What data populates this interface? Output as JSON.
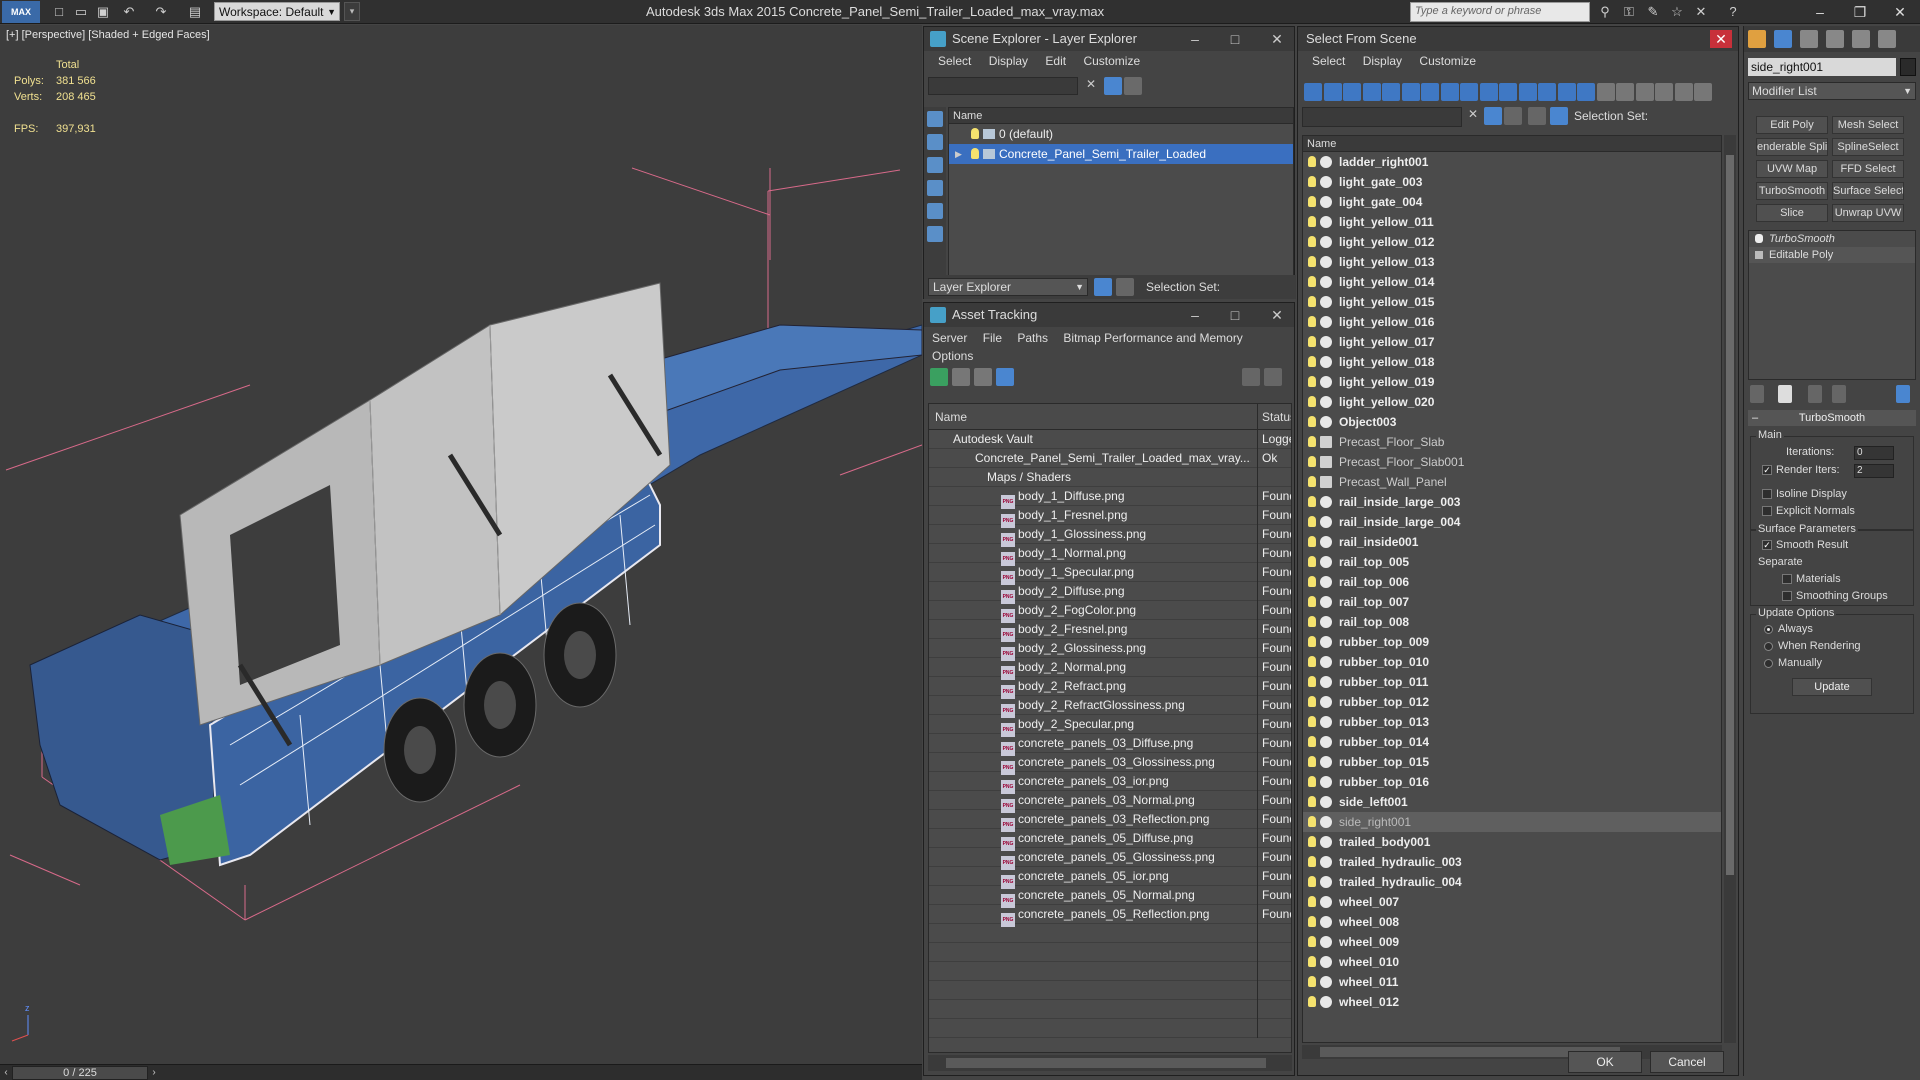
{
  "titlebar": {
    "logo": "MAX",
    "workspace": "Workspace: Default",
    "title": "Autodesk 3ds Max  2015     Concrete_Panel_Semi_Trailer_Loaded_max_vray.max",
    "search_placeholder": "Type a keyword or phrase"
  },
  "viewport": {
    "label": "[+] [Perspective] [Shaded + Edged Faces]",
    "stats_total": "Total",
    "polys_label": "Polys:",
    "polys_value": "381 566",
    "verts_label": "Verts:",
    "verts_value": "208 465",
    "fps_label": "FPS:",
    "fps_value": "397,931"
  },
  "statusbar": {
    "frame": "0 / 225"
  },
  "scene_explorer": {
    "title": "Scene Explorer - Layer Explorer",
    "menu": [
      "Select",
      "Display",
      "Edit",
      "Customize"
    ],
    "column": "Name",
    "rows": [
      "0 (default)",
      "Concrete_Panel_Semi_Trailer_Loaded"
    ],
    "layer_dropdown": "Layer Explorer",
    "selection_set": "Selection Set:"
  },
  "asset_tracking": {
    "title": "Asset Tracking",
    "menu": [
      "Server",
      "File",
      "Paths",
      "Bitmap Performance and Memory",
      "Options"
    ],
    "col_name": "Name",
    "col_status": "Status",
    "vault": {
      "name": "Autodesk Vault",
      "status": "Logge"
    },
    "file": {
      "name": "Concrete_Panel_Semi_Trailer_Loaded_max_vray....",
      "status": "Ok"
    },
    "maps": "Maps / Shaders",
    "found": "Found",
    "png": "PNG",
    "files": [
      "body_1_Diffuse.png",
      "body_1_Fresnel.png",
      "body_1_Glossiness.png",
      "body_1_Normal.png",
      "body_1_Specular.png",
      "body_2_Diffuse.png",
      "body_2_FogColor.png",
      "body_2_Fresnel.png",
      "body_2_Glossiness.png",
      "body_2_Normal.png",
      "body_2_Refract.png",
      "body_2_RefractGlossiness.png",
      "body_2_Specular.png",
      "concrete_panels_03_Diffuse.png",
      "concrete_panels_03_Glossiness.png",
      "concrete_panels_03_ior.png",
      "concrete_panels_03_Normal.png",
      "concrete_panels_03_Reflection.png",
      "concrete_panels_05_Diffuse.png",
      "concrete_panels_05_Glossiness.png",
      "concrete_panels_05_ior.png",
      "concrete_panels_05_Normal.png",
      "concrete_panels_05_Reflection.png"
    ]
  },
  "select_from_scene": {
    "title": "Select From Scene",
    "menu": [
      "Select",
      "Display",
      "Customize"
    ],
    "selection_set": "Selection Set:",
    "column": "Name",
    "objects": [
      {
        "name": "ladder_right001",
        "style": "normal"
      },
      {
        "name": "light_gate_003",
        "style": "normal"
      },
      {
        "name": "light_gate_004",
        "style": "normal"
      },
      {
        "name": "light_yellow_011",
        "style": "normal"
      },
      {
        "name": "light_yellow_012",
        "style": "normal"
      },
      {
        "name": "light_yellow_013",
        "style": "normal"
      },
      {
        "name": "light_yellow_014",
        "style": "normal"
      },
      {
        "name": "light_yellow_015",
        "style": "normal"
      },
      {
        "name": "light_yellow_016",
        "style": "normal"
      },
      {
        "name": "light_yellow_017",
        "style": "normal"
      },
      {
        "name": "light_yellow_018",
        "style": "normal"
      },
      {
        "name": "light_yellow_019",
        "style": "normal"
      },
      {
        "name": "light_yellow_020",
        "style": "normal"
      },
      {
        "name": "Object003",
        "style": "normal"
      },
      {
        "name": "Precast_Floor_Slab",
        "style": "dim"
      },
      {
        "name": "Precast_Floor_Slab001",
        "style": "dim"
      },
      {
        "name": "Precast_Wall_Panel",
        "style": "dim"
      },
      {
        "name": "rail_inside_large_003",
        "style": "normal"
      },
      {
        "name": "rail_inside_large_004",
        "style": "normal"
      },
      {
        "name": "rail_inside001",
        "style": "normal"
      },
      {
        "name": "rail_top_005",
        "style": "normal"
      },
      {
        "name": "rail_top_006",
        "style": "normal"
      },
      {
        "name": "rail_top_007",
        "style": "normal"
      },
      {
        "name": "rail_top_008",
        "style": "normal"
      },
      {
        "name": "rubber_top_009",
        "style": "normal"
      },
      {
        "name": "rubber_top_010",
        "style": "normal"
      },
      {
        "name": "rubber_top_011",
        "style": "normal"
      },
      {
        "name": "rubber_top_012",
        "style": "normal"
      },
      {
        "name": "rubber_top_013",
        "style": "normal"
      },
      {
        "name": "rubber_top_014",
        "style": "normal"
      },
      {
        "name": "rubber_top_015",
        "style": "normal"
      },
      {
        "name": "rubber_top_016",
        "style": "normal"
      },
      {
        "name": "side_left001",
        "style": "normal"
      },
      {
        "name": "side_right001",
        "style": "selected"
      },
      {
        "name": "trailed_body001",
        "style": "normal"
      },
      {
        "name": "trailed_hydraulic_003",
        "style": "normal"
      },
      {
        "name": "trailed_hydraulic_004",
        "style": "normal"
      },
      {
        "name": "wheel_007",
        "style": "normal"
      },
      {
        "name": "wheel_008",
        "style": "normal"
      },
      {
        "name": "wheel_009",
        "style": "normal"
      },
      {
        "name": "wheel_010",
        "style": "normal"
      },
      {
        "name": "wheel_011",
        "style": "normal"
      },
      {
        "name": "wheel_012",
        "style": "normal"
      }
    ],
    "ok": "OK",
    "cancel": "Cancel"
  },
  "command_panel": {
    "object_name": "side_right001",
    "modifier_list": "Modifier List",
    "buttons": [
      "Edit Poly",
      "Mesh Select",
      "enderable Splir",
      "SplineSelect",
      "UVW Map",
      "FFD Select",
      "TurboSmooth",
      "Surface Select",
      "Slice",
      "Unwrap UVW"
    ],
    "stack": [
      "TurboSmooth",
      "Editable Poly"
    ],
    "rollout_title": "TurboSmooth",
    "main": "Main",
    "iterations_label": "Iterations:",
    "iterations_value": "0",
    "render_iters_label": "Render Iters:",
    "render_iters_value": "2",
    "isoline": "Isoline Display",
    "explicit": "Explicit Normals",
    "surface_params": "Surface Parameters",
    "smooth_result": "Smooth Result",
    "separate": "Separate",
    "materials": "Materials",
    "smoothing_groups": "Smoothing Groups",
    "update_options": "Update Options",
    "always": "Always",
    "when_rendering": "When Rendering",
    "manually": "Manually",
    "update": "Update"
  },
  "colors": {
    "selection_blue": "#3a6fc0",
    "trailer_blue": "#3e68a8",
    "bounding_pink": "#d86a8a",
    "stats_yellow": "#f0e090"
  }
}
